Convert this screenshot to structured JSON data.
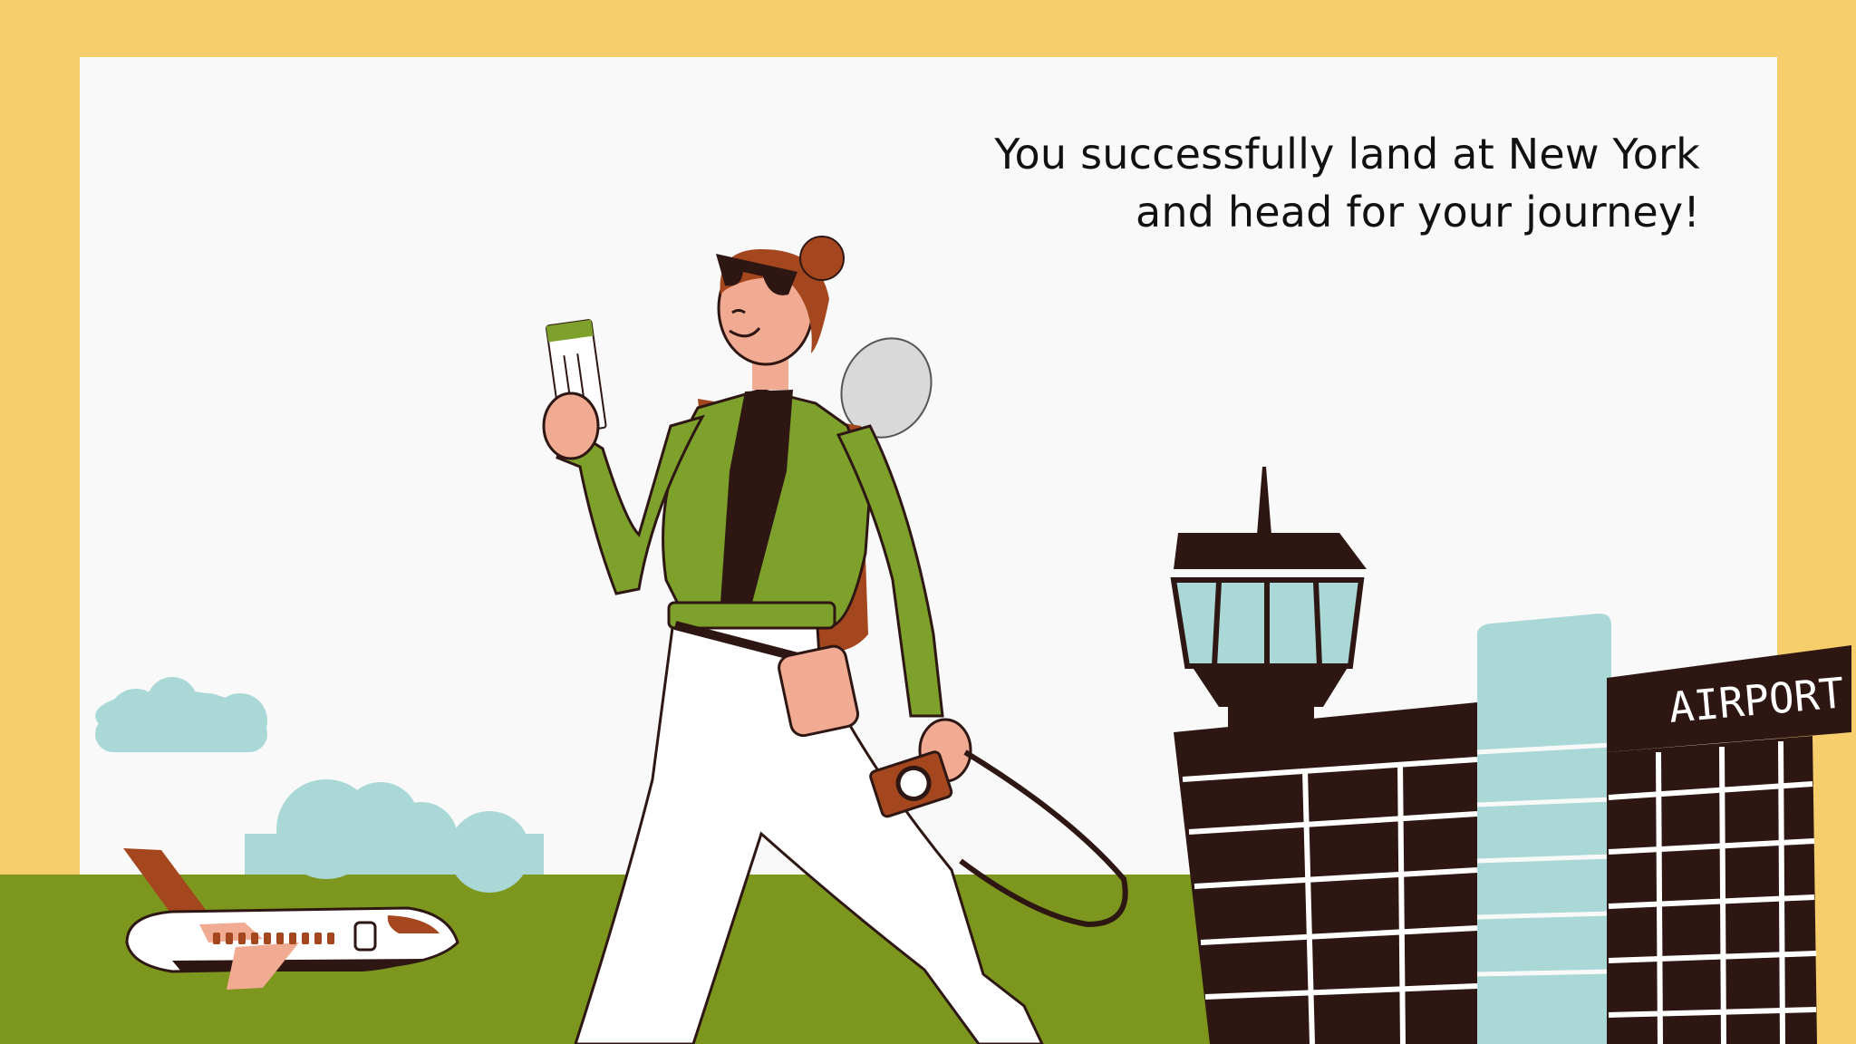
{
  "colors": {
    "frame": "#f7ce6c",
    "panel": "#f9f9f9",
    "grass": "#7d961d",
    "jacket": "#7ea12c",
    "dark": "#2e1713",
    "glass": "#a9d8d6",
    "rust": "#a5471e",
    "skin": "#f1ab93",
    "cloud": "#a9d8d6"
  },
  "caption": {
    "line1": "You successfully land at New York",
    "line2": "and head for your journey!"
  },
  "airport": {
    "sign": "AIRPORT"
  }
}
